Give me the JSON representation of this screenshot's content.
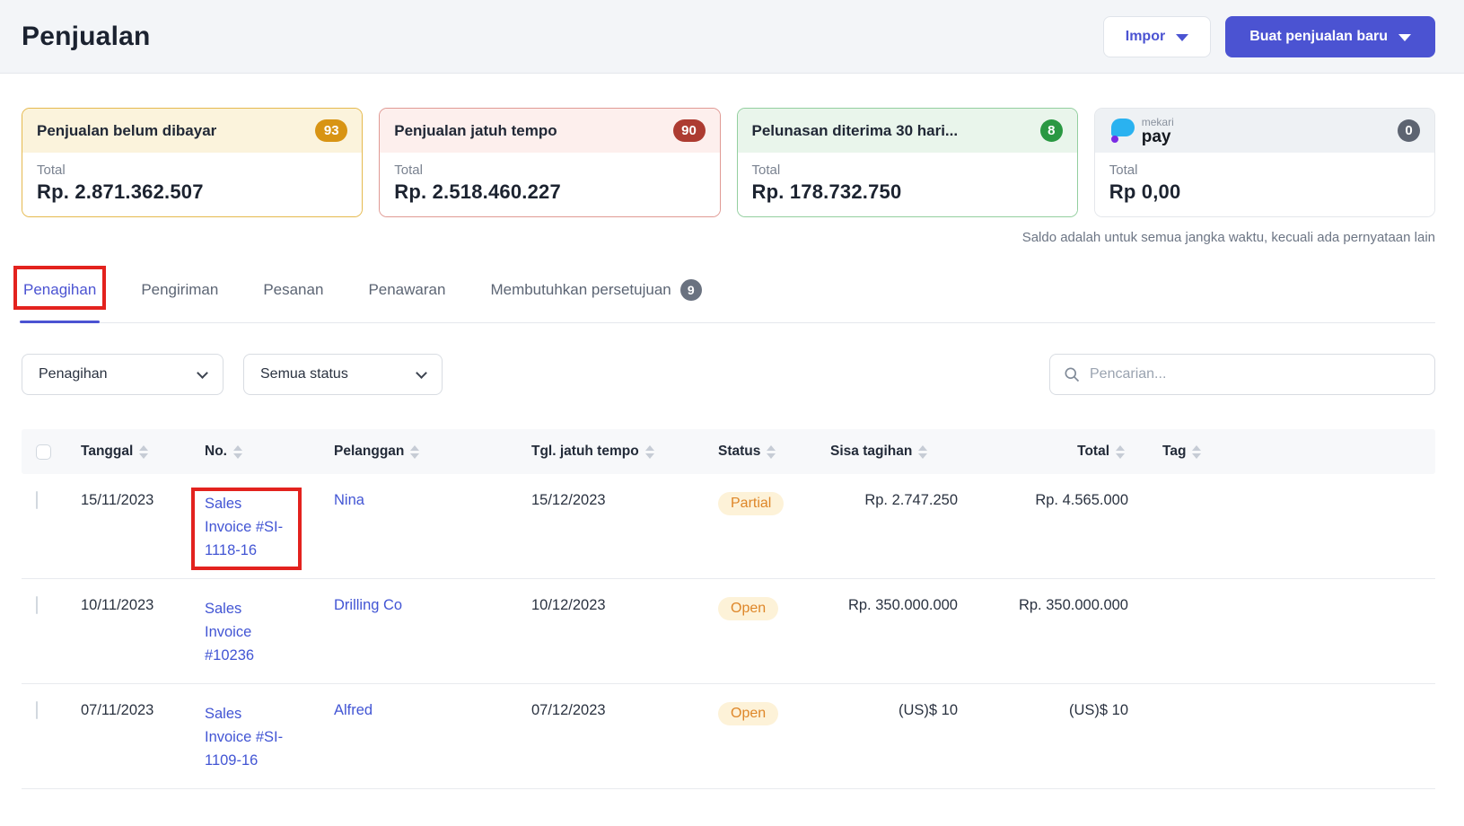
{
  "colors": {
    "accent": "#4b53d2",
    "link": "#4255d4",
    "annotation": "#e3221e",
    "status_text": "#de8628",
    "status_bg": "#fdf2d8",
    "badge_amber": "#d89414",
    "badge_red": "#ad3b31",
    "badge_green": "#2a9842",
    "badge_gray": "#5d6471"
  },
  "header": {
    "title": "Penjualan",
    "import_button": "Impor",
    "create_button": "Buat penjualan baru"
  },
  "summary_cards": [
    {
      "title": "Penjualan belum dibayar",
      "count": "93",
      "total_label": "Total",
      "amount": "Rp. 2.871.362.507"
    },
    {
      "title": "Penjualan jatuh tempo",
      "count": "90",
      "total_label": "Total",
      "amount": "Rp. 2.518.460.227"
    },
    {
      "title": "Pelunasan diterima 30 hari...",
      "count": "8",
      "total_label": "Total",
      "amount": "Rp. 178.732.750"
    },
    {
      "brand": "mekari",
      "brand_product": "pay",
      "count": "0",
      "total_label": "Total",
      "amount": "Rp 0,00"
    }
  ],
  "balance_note": "Saldo adalah untuk semua jangka waktu, kecuali ada pernyataan lain",
  "tabs": [
    {
      "label": "Penagihan"
    },
    {
      "label": "Pengiriman"
    },
    {
      "label": "Pesanan"
    },
    {
      "label": "Penawaran"
    },
    {
      "label": "Membutuhkan persetujuan",
      "badge": "9"
    }
  ],
  "filters": {
    "type_selected": "Penagihan",
    "status_selected": "Semua status",
    "search_placeholder": "Pencarian..."
  },
  "table": {
    "columns": [
      "Tanggal",
      "No.",
      "Pelanggan",
      "Tgl. jatuh tempo",
      "Status",
      "Sisa tagihan",
      "Total",
      "Tag"
    ],
    "rows": [
      {
        "date": "15/11/2023",
        "number": "Sales Invoice #SI-1118-16",
        "customer": "Nina",
        "due_date": "15/12/2023",
        "status": "Partial",
        "remaining": "Rp. 2.747.250",
        "total": "Rp. 4.565.000",
        "tag": ""
      },
      {
        "date": "10/11/2023",
        "number": "Sales Invoice #10236",
        "customer": "Drilling Co",
        "due_date": "10/12/2023",
        "status": "Open",
        "remaining": "Rp. 350.000.000",
        "total": "Rp. 350.000.000",
        "tag": ""
      },
      {
        "date": "07/11/2023",
        "number": "Sales Invoice #SI-1109-16",
        "customer": "Alfred",
        "due_date": "07/12/2023",
        "status": "Open",
        "remaining": "(US)$ 10",
        "total": "(US)$ 10",
        "tag": ""
      }
    ]
  }
}
